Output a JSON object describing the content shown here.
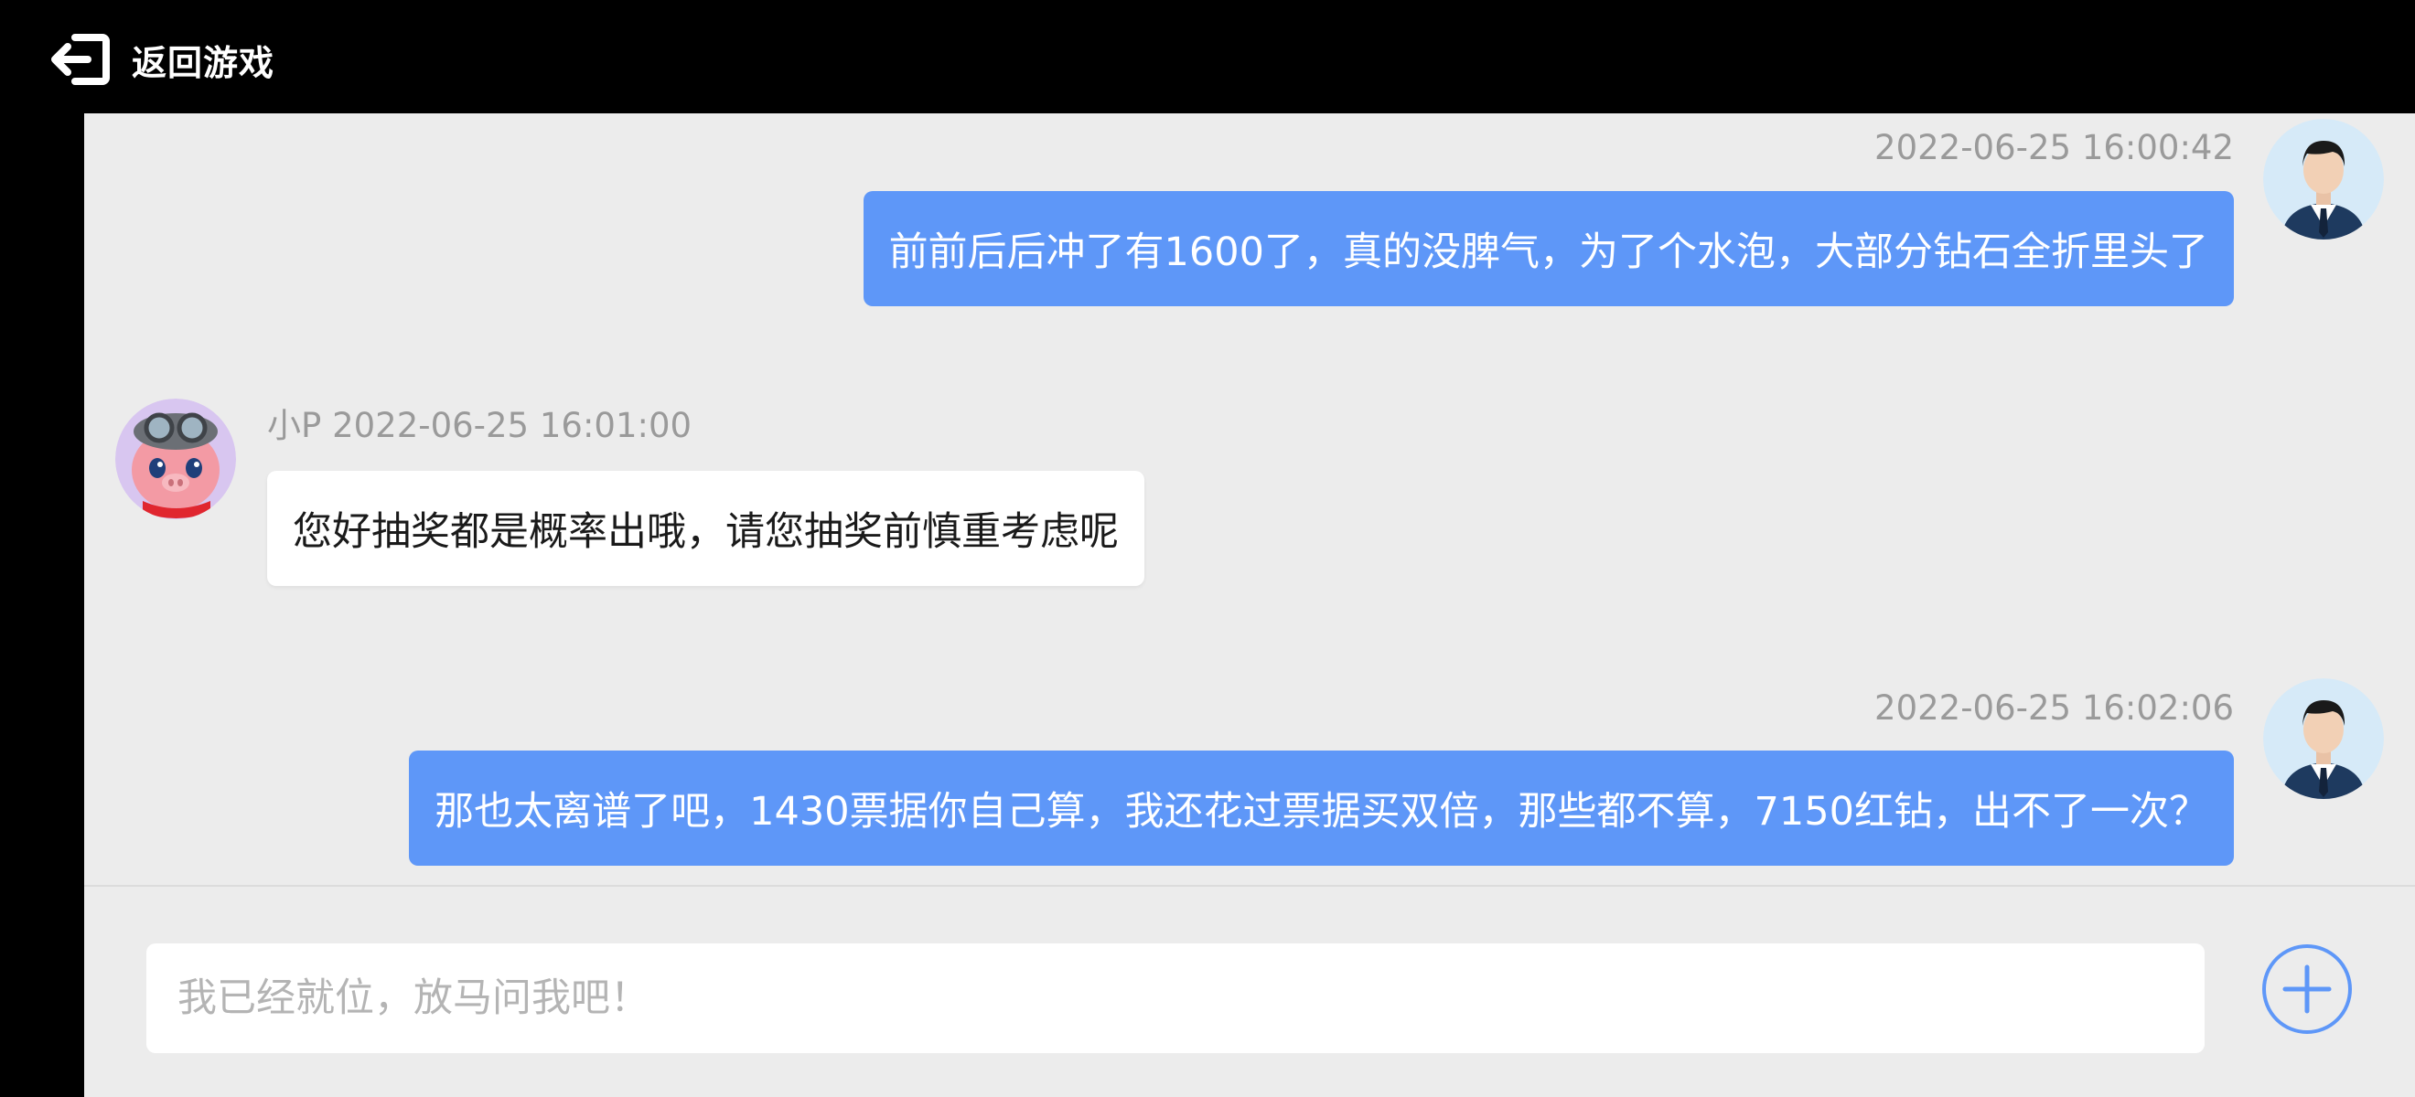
{
  "header": {
    "back_label": "返回游戏",
    "back_icon": "exit-arrow-icon"
  },
  "messages": [
    {
      "sender": "user",
      "timestamp": "2022-06-25 16:00:42",
      "text": "前前后后冲了有1600了，真的没脾气，为了个水泡，大部分钻石全折里头了"
    },
    {
      "sender": "bot",
      "meta": "小P 2022-06-25 16:01:00",
      "text": "您好抽奖都是概率出哦，请您抽奖前慎重考虑呢"
    },
    {
      "sender": "user",
      "timestamp": "2022-06-25 16:02:06",
      "text": "那也太离谱了吧，1430票据你自己算，我还花过票据买双倍，那些都不算，7150红钻，出不了一次？"
    }
  ],
  "input": {
    "value": "",
    "placeholder": "我已经就位，放马问我吧！"
  },
  "actions": {
    "plus_icon": "plus-circle-icon"
  },
  "colors": {
    "user_bubble": "#5e97f8",
    "bot_bubble": "#ffffff",
    "chat_background": "#ececec",
    "timestamp": "#9a9a9a",
    "accent": "#5e97f8"
  }
}
